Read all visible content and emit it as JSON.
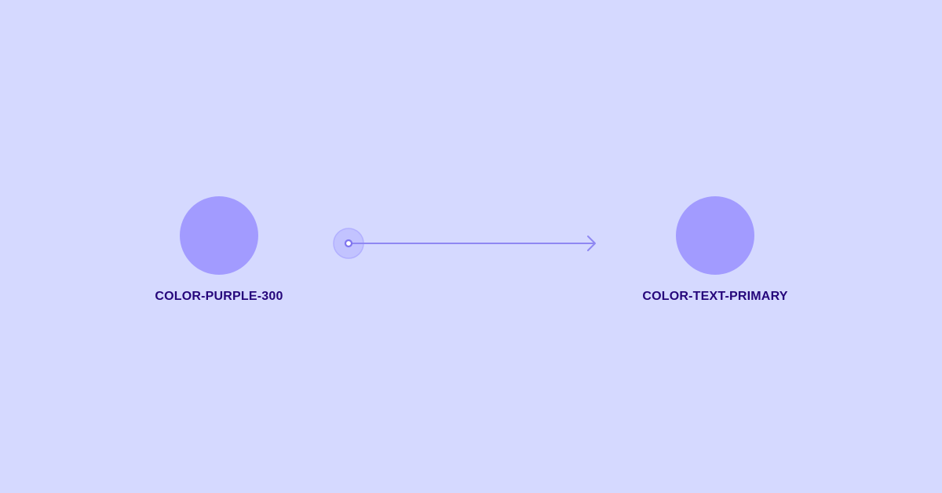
{
  "diagram": {
    "source": {
      "label": "COLOR-PURPLE-300",
      "swatch_color": "#a29bff"
    },
    "target": {
      "label": "COLOR-TEXT-PRIMARY",
      "swatch_color": "#a29bff"
    },
    "connector": {
      "color": "#8f88f2",
      "handle_fill": "#c2c3ff",
      "direction": "left-to-right"
    }
  }
}
